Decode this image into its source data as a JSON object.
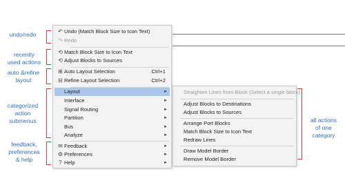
{
  "annotations": {
    "undo_redo": "undo/redo",
    "recent": "recently\nused actions",
    "auto_refine": "auto &refine\nlayout",
    "categorized": "categorized\naction\nsubmenus",
    "feedback": "feedback,\npreferences\n& help",
    "all_actions": "all actions\nof one\ncategory"
  },
  "menu": {
    "undo": {
      "icon": "undo-icon",
      "glyph": "↶",
      "label": "Undo (Match Block Size to Icon Text)"
    },
    "redo": {
      "icon": "redo-icon",
      "glyph": "↷",
      "label": "Redo"
    },
    "recent_1": {
      "icon": "history-icon",
      "glyph": "⟲",
      "label": "Match Block Size to Icon Text"
    },
    "recent_2": {
      "icon": "history-icon",
      "glyph": "⟲",
      "label": "Adjust Blocks to Sources"
    },
    "auto_layout": {
      "icon": "auto-layout-icon",
      "glyph": "⊞",
      "label": "Auto Layout Selection",
      "shortcut": "Ctrl+1"
    },
    "refine_layout": {
      "icon": "refine-layout-icon",
      "glyph": "⊟",
      "label": "Refine Layout Selection",
      "shortcut": "Ctrl+2"
    },
    "categories": [
      {
        "label": "Layout",
        "arrow": "►"
      },
      {
        "label": "Interface",
        "arrow": "►"
      },
      {
        "label": "Signal Routing",
        "arrow": "►"
      },
      {
        "label": "Partition",
        "arrow": "►"
      },
      {
        "label": "Bus",
        "arrow": "►"
      },
      {
        "label": "Analyze",
        "arrow": "►"
      }
    ],
    "feedback": {
      "icon": "feedback-icon",
      "glyph": "✉",
      "label": "Feedback",
      "arrow": "►"
    },
    "preferences": {
      "icon": "gear-icon",
      "glyph": "⚙",
      "label": "Preferences",
      "arrow": "►"
    },
    "help": {
      "icon": "help-icon",
      "glyph": "?",
      "label": "Help",
      "arrow": "►"
    }
  },
  "submenu": {
    "hint": "Straighten Lines from Block (Select a single block)",
    "items": [
      "Adjust Blocks to Destinations",
      "Adjust Blocks to Sources",
      "Arrange Port Blocks",
      "Match Block Size to Icon Text",
      "Redraw Lines",
      "Draw Model Border",
      "Remove Model Border"
    ]
  },
  "colors": {
    "annotation": "#2f6fd2",
    "bracket": "#e03a2f",
    "selection": "#a9c7eb"
  }
}
